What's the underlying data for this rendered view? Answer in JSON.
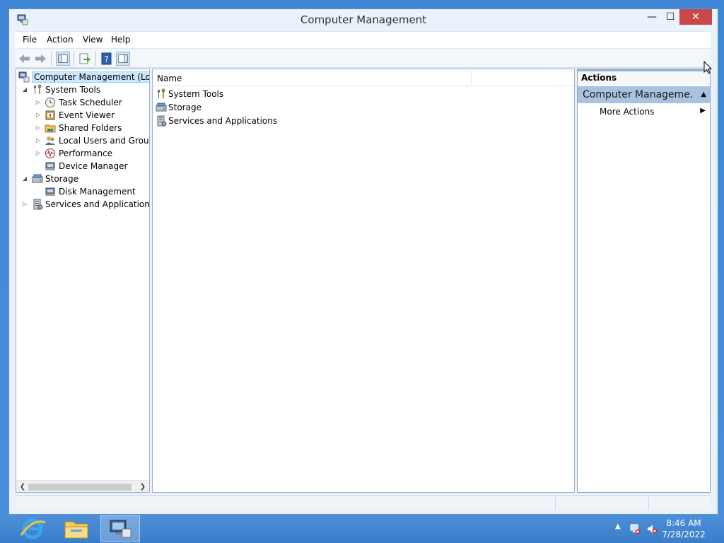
{
  "window": {
    "title": "Computer Management",
    "minimize_glyph": "—",
    "maximize_glyph": "☐",
    "close_glyph": "✕"
  },
  "menu": [
    "File",
    "Action",
    "View",
    "Help"
  ],
  "toolbar": {
    "icons": [
      "back-arrow-icon",
      "forward-arrow-icon",
      "show-hide-console-tree-icon",
      "export-list-icon",
      "help-icon",
      "show-hide-action-pane-icon"
    ]
  },
  "tree": {
    "root": "Computer Management (Local",
    "system_tools": "System Tools",
    "task_scheduler": "Task Scheduler",
    "event_viewer": "Event Viewer",
    "shared_folders": "Shared Folders",
    "local_users": "Local Users and Groups",
    "performance": "Performance",
    "device_manager": "Device Manager",
    "storage": "Storage",
    "disk_management": "Disk Management",
    "services": "Services and Applications"
  },
  "list": {
    "column_name": "Name",
    "items": [
      "System Tools",
      "Storage",
      "Services and Applications"
    ]
  },
  "actions": {
    "title": "Actions",
    "section": "Computer Manageme...",
    "more_actions": "More Actions"
  },
  "taskbar": {
    "time": "8:46 AM",
    "date": "7/28/2022"
  },
  "colors": {
    "desktop": "#3f86d6",
    "close_button": "#c74949",
    "actions_section": "#a9c2df",
    "selection": "#cce8ff"
  }
}
